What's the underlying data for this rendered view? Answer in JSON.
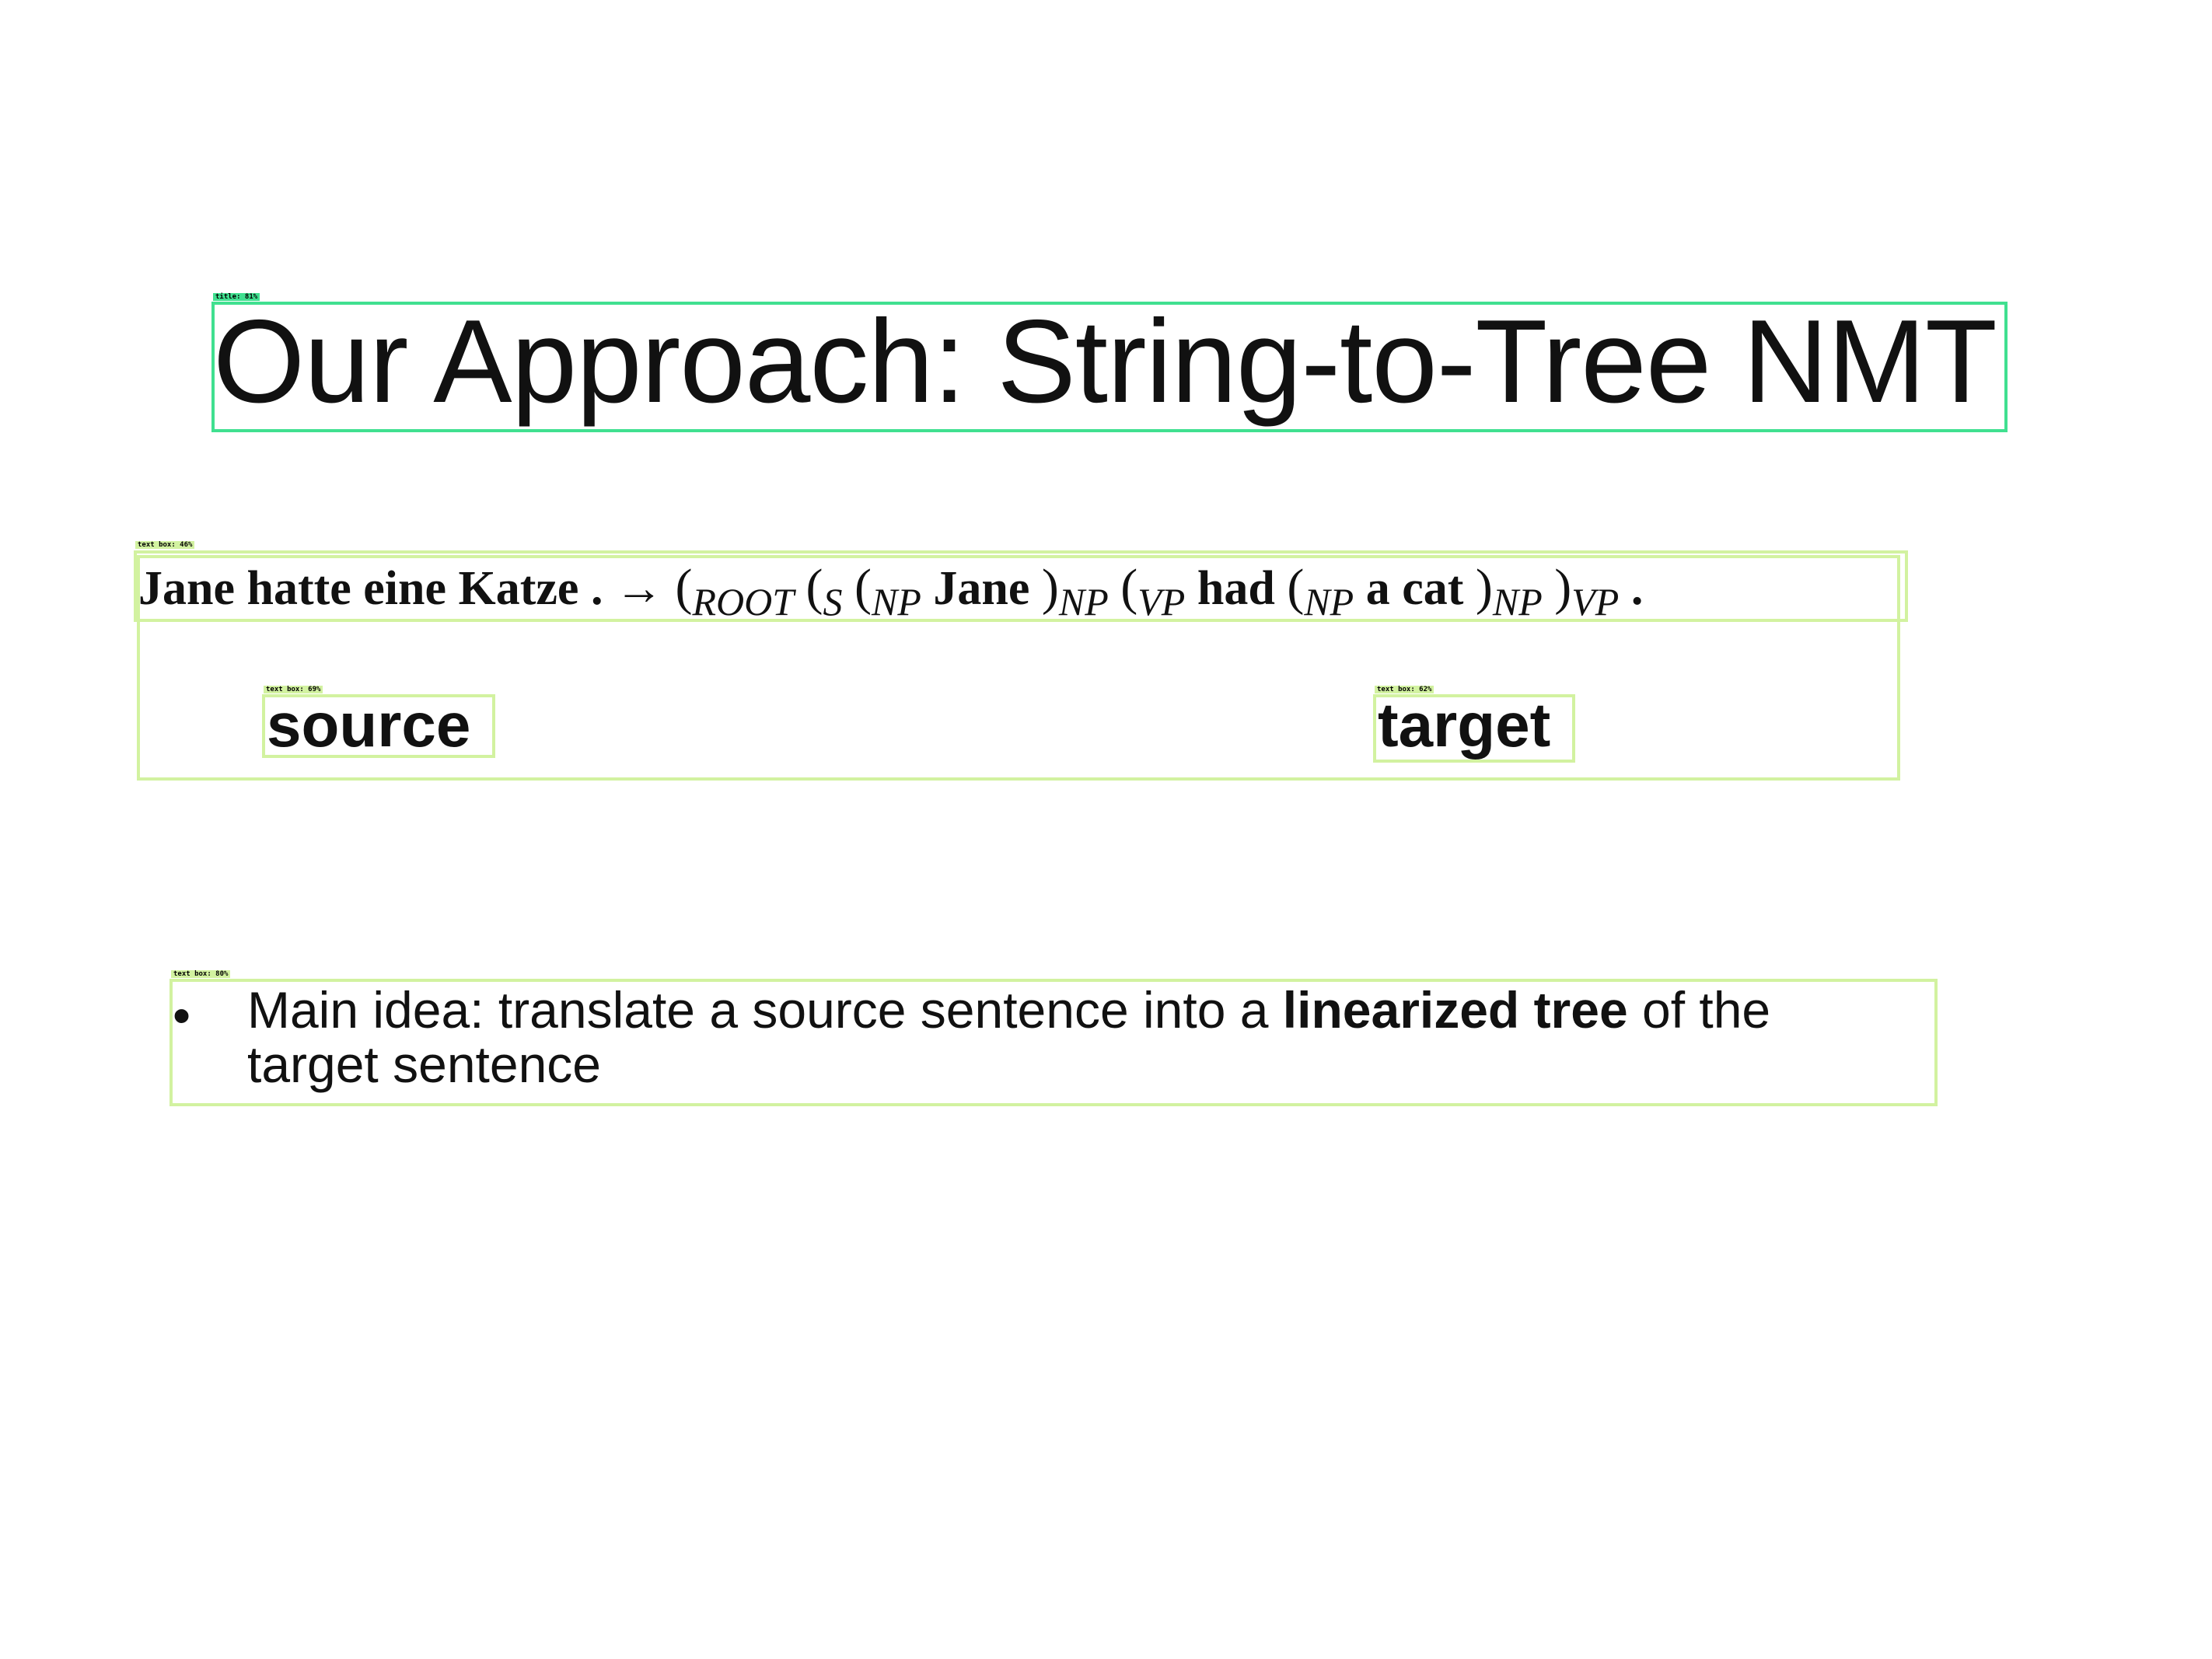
{
  "slide": {
    "title": "Our Approach: String-to-Tree NMT",
    "formula": {
      "source_words": "Jane hatte eine Katze .",
      "arrow": "→",
      "tokens": [
        "(",
        "ROOT",
        "(",
        "S",
        "(",
        "NP",
        "Jane",
        ")",
        "NP",
        "(",
        "VP",
        "had",
        "(",
        "NP",
        "a cat",
        ")",
        "NP",
        ")",
        "VP",
        "."
      ]
    },
    "labels": {
      "source": "source",
      "target": "target"
    },
    "bullet": {
      "marker": "•",
      "prefix": "Main idea: translate a source sentence into a ",
      "emphasis": "linearized tree",
      "suffix": " of the",
      "line2": "target sentence"
    }
  },
  "detections": {
    "title": "title: 81%",
    "formula": "text box: 46%",
    "source": "text box: 69%",
    "target": "text box: 62%",
    "bullet": "text box: 80%"
  },
  "colors": {
    "title_box": "#40e090",
    "text_box": "#d2f2a0"
  }
}
